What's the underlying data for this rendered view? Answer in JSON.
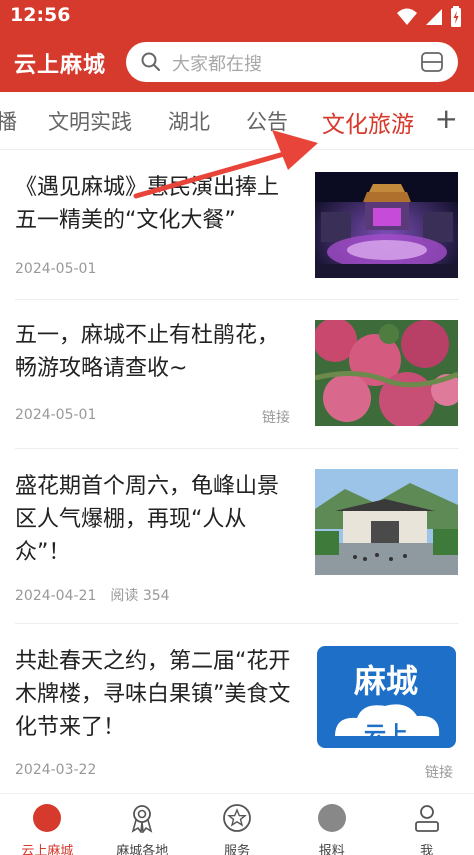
{
  "status_bar": {
    "time": "12:56"
  },
  "app_bar": {
    "title": "云上麻城",
    "search_placeholder": "大家都在搜"
  },
  "tabs": [
    {
      "label": "播"
    },
    {
      "label": "文明实践"
    },
    {
      "label": "湖北"
    },
    {
      "label": "公告"
    },
    {
      "label": "文化旅游"
    }
  ],
  "tabs_add": "+",
  "articles": [
    {
      "title": "《遇见麻城》惠民演出捧上五一精美的“文化大餐”",
      "date": "2024-05-01",
      "reads": "",
      "tag": ""
    },
    {
      "title": "五一，麻城不止有杜鹃花，畅游攻略请查收~",
      "date": "2024-05-01",
      "reads": "",
      "tag": "链接"
    },
    {
      "title": "盛花期首个周六，龟峰山景区人气爆棚，再现“人从众”！",
      "date": "2024-04-21",
      "reads": "阅读 354",
      "tag": ""
    },
    {
      "title": "共赴春天之约，第二届“花开木牌楼，寻味白果镇”美食文化节来了！",
      "date": "2024-03-22",
      "reads": "",
      "tag": "链接",
      "thumb_text_1": "麻城",
      "thumb_text_2": "云上"
    }
  ],
  "bottom_nav": [
    {
      "label": "云上麻城"
    },
    {
      "label": "麻城各地"
    },
    {
      "label": "服务"
    },
    {
      "label": "报料"
    },
    {
      "label": "我"
    }
  ],
  "colors": {
    "brand_red": "#d63a2c",
    "annotation_red": "#e8443a"
  }
}
